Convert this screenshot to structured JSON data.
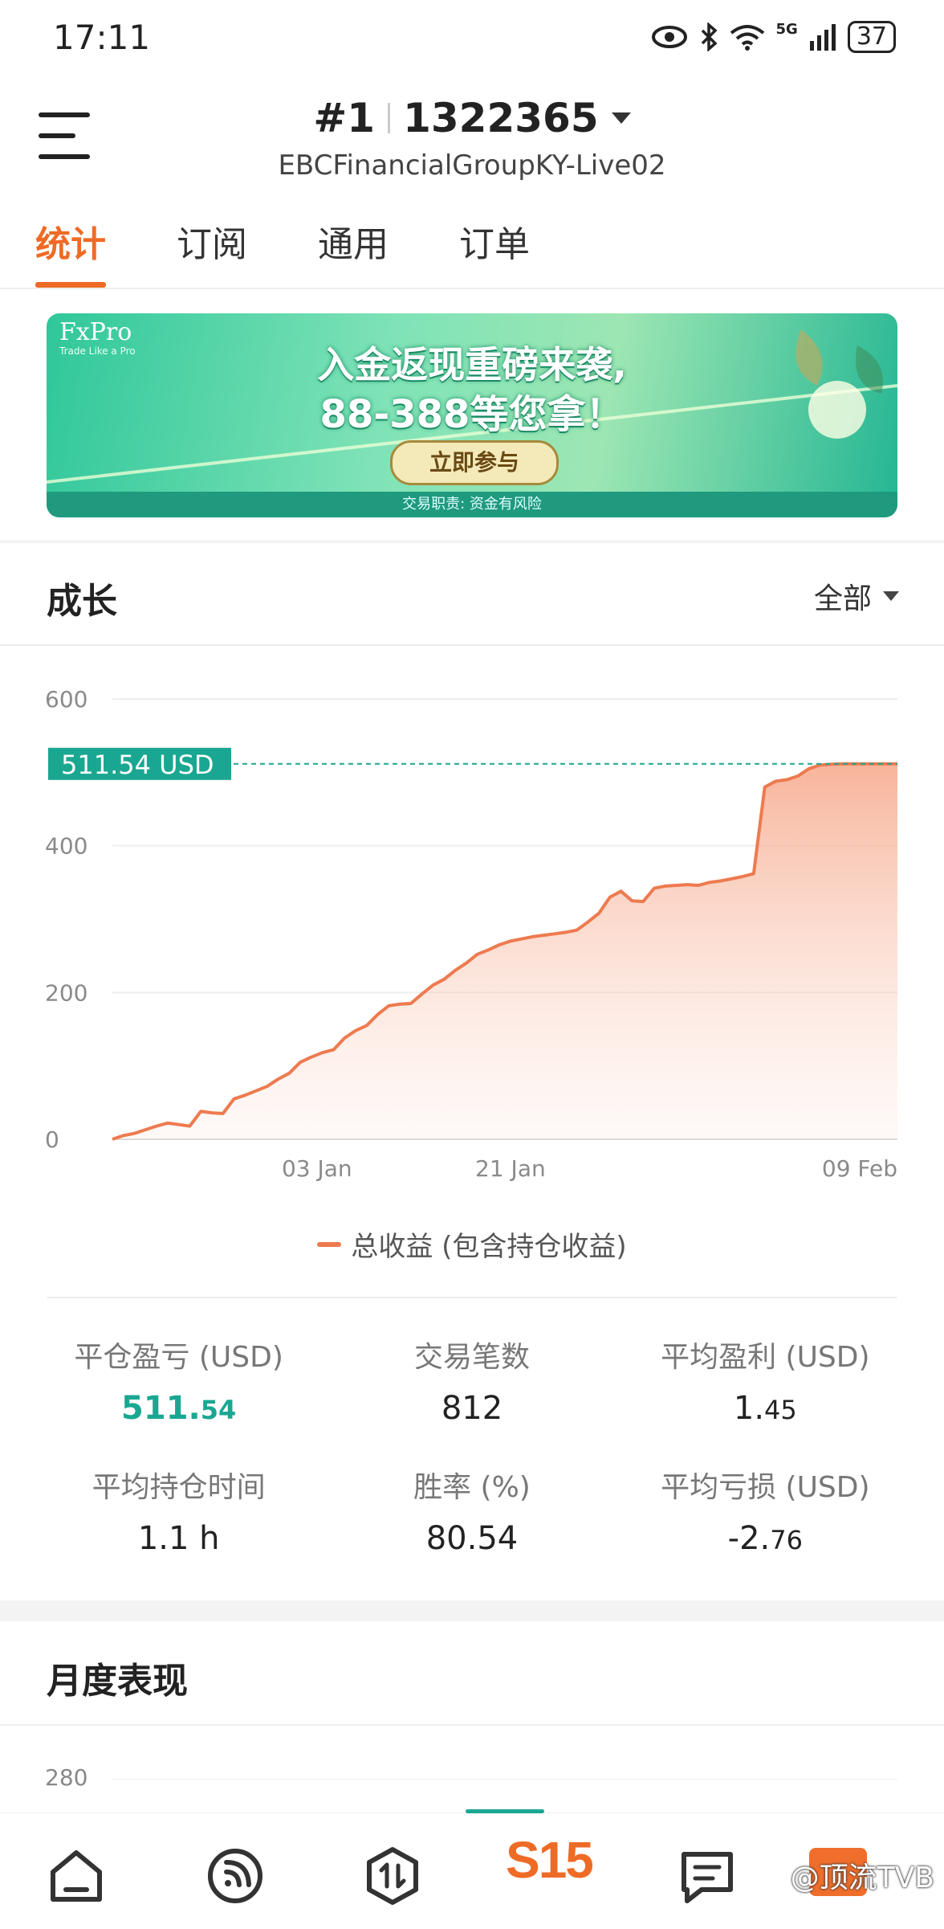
{
  "status_bar": {
    "time": "17:11",
    "battery": "37",
    "network": "5G"
  },
  "header": {
    "account_num": "#1",
    "account_id": "1322365",
    "server": "EBCFinancialGroupKY-Live02"
  },
  "tabs": [
    {
      "label": "统计",
      "active": true
    },
    {
      "label": "订阅",
      "active": false
    },
    {
      "label": "通用",
      "active": false
    },
    {
      "label": "订单",
      "active": false
    }
  ],
  "banner": {
    "brand": "FxPro",
    "brand_sub": "Trade Like a Pro",
    "headline1": "入金返现重磅来袭,",
    "headline2": "88-388等您拿！",
    "cta": "立即参与",
    "footer": "交易职责: 资金有风险"
  },
  "growth": {
    "title": "成长",
    "filter": "全部"
  },
  "chart_data": {
    "type": "area",
    "title": "",
    "xlabel": "",
    "ylabel": "",
    "ylim": [
      0,
      600
    ],
    "yticks": [
      0,
      200,
      400,
      600
    ],
    "ytick_labels": [
      "0",
      "200",
      "400",
      "600"
    ],
    "x_tick_labels": [
      "03 Jan",
      "21 Jan",
      "09 Feb"
    ],
    "current_value_label": "511.54 USD",
    "current_value": 511.54,
    "color": "#ee7a4f",
    "accent": "#1aa792",
    "series": [
      {
        "name": "总收益 (包含持仓收益)",
        "x_index": [
          0,
          1,
          2,
          3,
          4,
          5,
          6,
          7,
          8,
          9,
          10,
          11,
          12,
          13,
          14,
          15,
          16,
          17,
          18,
          19,
          20,
          21,
          22,
          23,
          24,
          25,
          26,
          27,
          28,
          29,
          30,
          31,
          32,
          33,
          34,
          35,
          36,
          37,
          38,
          39,
          40,
          41,
          42,
          43,
          44,
          45,
          46,
          47,
          48,
          49,
          50,
          51,
          52,
          53,
          54,
          55,
          56,
          57,
          58,
          59,
          60,
          61,
          62,
          63,
          64,
          65,
          66,
          67,
          68,
          69,
          70,
          71
        ],
        "values": [
          0,
          5,
          8,
          13,
          18,
          22,
          20,
          18,
          38,
          36,
          35,
          55,
          60,
          66,
          72,
          82,
          90,
          105,
          112,
          118,
          122,
          138,
          148,
          155,
          170,
          182,
          184,
          185,
          198,
          210,
          218,
          230,
          240,
          252,
          258,
          265,
          270,
          273,
          276,
          278,
          280,
          282,
          285,
          296,
          308,
          330,
          338,
          325,
          324,
          342,
          345,
          346,
          347,
          346,
          350,
          352,
          355,
          358,
          362,
          480,
          488,
          490,
          495,
          505,
          510,
          511,
          511.54,
          511.54,
          511.54,
          511.54,
          511.54,
          511.54
        ]
      }
    ],
    "x_label_positions": [
      18.5,
      36,
      71
    ],
    "legend": "总收益 (包含持仓收益)"
  },
  "stats": [
    {
      "label": "平仓盈亏 (USD)",
      "value_main": "511.",
      "value_small": "54",
      "style": "green"
    },
    {
      "label": "交易笔数",
      "value_main": "812",
      "value_small": "",
      "style": ""
    },
    {
      "label": "平均盈利 (USD)",
      "value_main": "1.",
      "value_small": "45",
      "style": ""
    },
    {
      "label": "平均持仓时间",
      "value_main": "1.1 h",
      "value_small": "",
      "style": ""
    },
    {
      "label": "胜率 (%)",
      "value_main": "80.54",
      "value_small": "",
      "style": ""
    },
    {
      "label": "平均亏损 (USD)",
      "value_main": "-2.",
      "value_small": "76",
      "style": ""
    }
  ],
  "monthly": {
    "title": "月度表现",
    "y_label": "280"
  },
  "bottom_nav": {
    "center_label": "S15",
    "watermark": "@顶流TVB"
  },
  "icons": {
    "menu": "menu-icon",
    "eye": "eye-icon",
    "bluetooth": "bluetooth-icon",
    "wifi": "wifi-icon",
    "signal": "signal-icon",
    "home": "home-icon",
    "feed": "feed-icon",
    "trade": "trade-icon",
    "messages": "messages-icon"
  }
}
